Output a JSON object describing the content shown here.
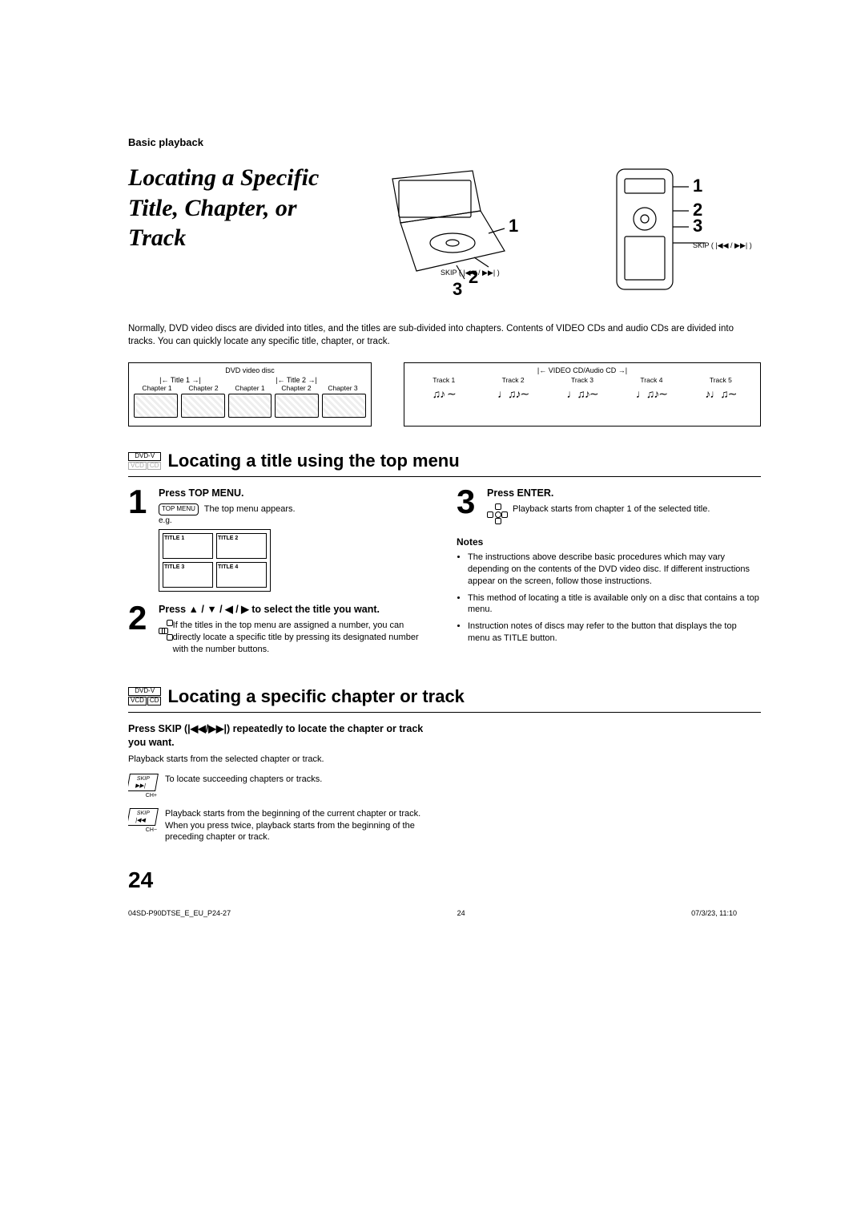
{
  "breadcrumb": "Basic playback",
  "title": "Locating a Specific Title, Chapter, or Track",
  "hero": {
    "playerCallouts": [
      "1",
      "2",
      "3"
    ],
    "playerSkipLabel": "SKIP ( |◀◀ / ▶▶| )",
    "remoteCallouts": [
      "1",
      "2",
      "3"
    ],
    "remoteSkipLabel": "SKIP ( |◀◀ / ▶▶| )"
  },
  "intro": "Normally, DVD video discs are divided into titles, and the titles are sub-divided into chapters. Contents of VIDEO CDs and audio CDs are divided into tracks. You can quickly locate any specific title, chapter, or track.",
  "dvdBox": {
    "header": "DVD video disc",
    "titles": [
      "Title 1",
      "Title 2"
    ],
    "chapters": [
      "Chapter 1",
      "Chapter 2",
      "Chapter 1",
      "Chapter 2",
      "Chapter 3"
    ]
  },
  "cdBox": {
    "header": "VIDEO CD/Audio CD",
    "tracks": [
      "Track 1",
      "Track 2",
      "Track 3",
      "Track 4",
      "Track 5"
    ]
  },
  "badges": {
    "dvd": "DVD-V",
    "vcd": "VCD",
    "cd": "CD"
  },
  "section1": {
    "title": "Locating a title using the top menu",
    "step1": {
      "num": "1",
      "title": "Press TOP MENU.",
      "btn": "TOP MENU",
      "desc": "The top menu appears.",
      "eg": "e.g.",
      "cells": [
        "TITLE 1",
        "TITLE 2",
        "TITLE 3",
        "TITLE 4"
      ]
    },
    "step2": {
      "num": "2",
      "title": "Press ▲ / ▼ / ◀ / ▶ to select the title you want.",
      "desc": "If the titles in the top menu are assigned a number, you can directly locate a specific title by pressing its designated number with the number buttons."
    },
    "step3": {
      "num": "3",
      "title": "Press ENTER.",
      "desc": "Playback starts from chapter 1 of the selected title."
    },
    "notesTitle": "Notes",
    "notes": [
      "The instructions above describe basic procedures which may vary depending on the contents of the DVD video disc. If different instructions appear on the screen, follow those instructions.",
      "This method of locating a title is available only on a disc that contains a top menu.",
      "Instruction notes of discs may refer to the button that displays the top menu as TITLE button."
    ]
  },
  "section2": {
    "title": "Locating a specific chapter or track",
    "stepTitle": "Press SKIP (|◀◀/▶▶|) repeatedly to locate the chapter or track you want.",
    "desc": "Playback starts from the selected chapter or track.",
    "fwd": {
      "btn": "SKIP ▶▶|",
      "sub": "CH+",
      "text": "To locate succeeding chapters or tracks."
    },
    "rev": {
      "btn": "SKIP |◀◀",
      "sub": "CH−",
      "text": "Playback starts from the beginning of the current chapter or track.\nWhen you press twice, playback starts from the beginning of the preceding chapter or track."
    }
  },
  "pageNumber": "24",
  "footer": {
    "left": "04SD-P90DTSE_E_EU_P24-27",
    "center": "24",
    "right": "07/3/23, 11:10"
  }
}
